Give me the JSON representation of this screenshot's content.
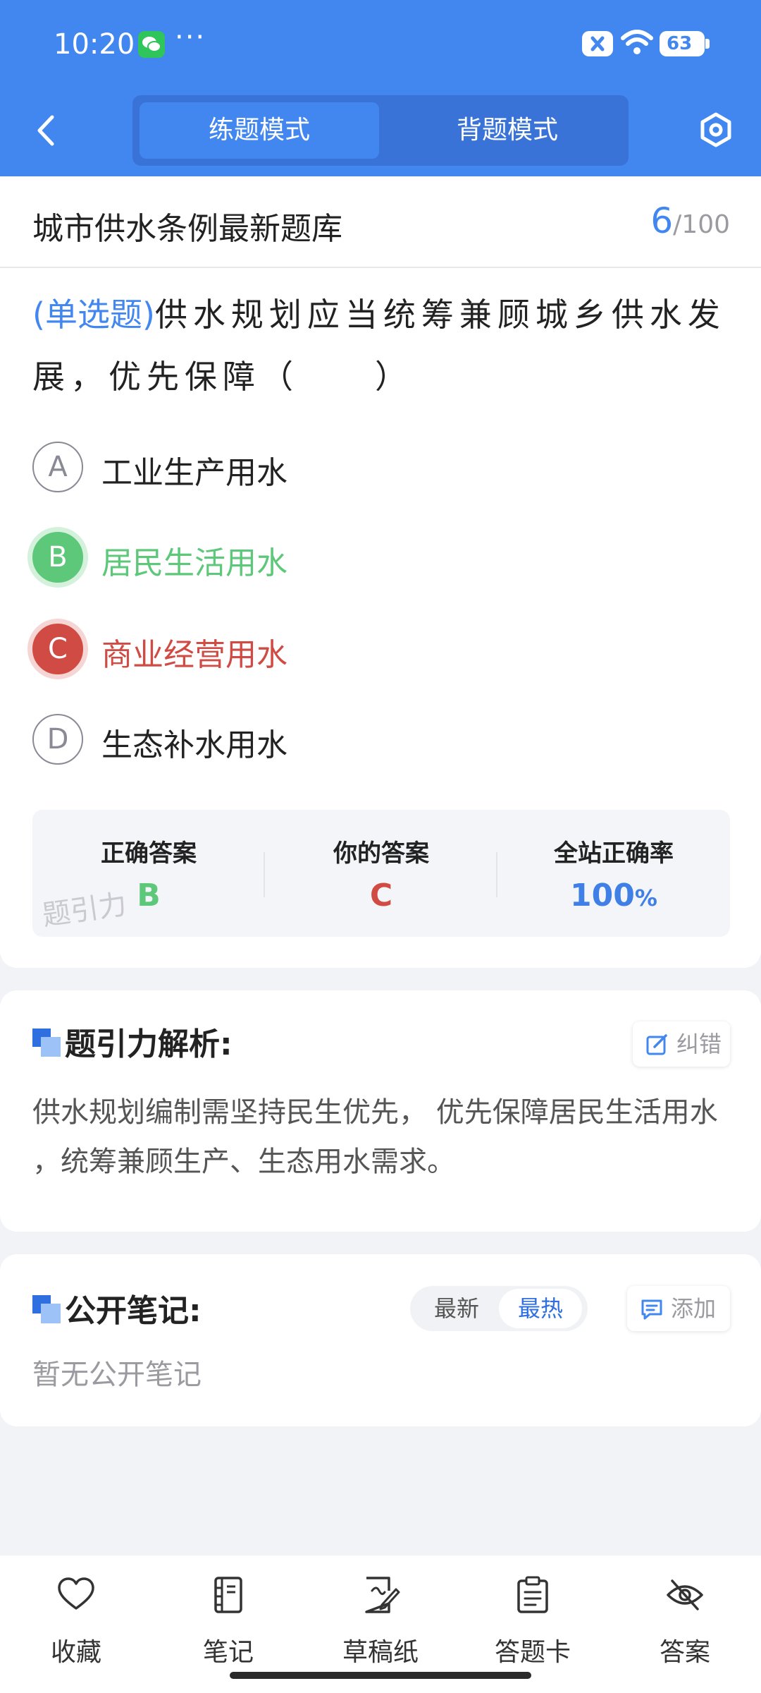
{
  "status_bar": {
    "time": "10:20",
    "overflow": "···",
    "battery": "63"
  },
  "header": {
    "tabs": [
      {
        "label": "练题模式",
        "active": true
      },
      {
        "label": "背题模式",
        "active": false
      }
    ],
    "icons": {
      "back": "chevron-left-icon",
      "settings": "hexagon-gear-icon"
    }
  },
  "title_row": {
    "bank_title": "城市供水条例最新题库",
    "current": "6",
    "total": "/100"
  },
  "question": {
    "type_label": "(单选题)",
    "text": "供水规划应当统筹兼顾城乡供水发展，优先保障（　　）",
    "options": [
      {
        "letter": "A",
        "text": "工业生产用水",
        "state": "normal"
      },
      {
        "letter": "B",
        "text": "居民生活用水",
        "state": "correct"
      },
      {
        "letter": "C",
        "text": "商业经营用水",
        "state": "wrong"
      },
      {
        "letter": "D",
        "text": "生态补水用水",
        "state": "normal"
      }
    ]
  },
  "answer_summary": {
    "correct_label": "正确答案",
    "correct_value": "B",
    "your_label": "你的答案",
    "your_value": "C",
    "rate_label": "全站正确率",
    "rate_value": "100",
    "rate_unit": "%",
    "watermark": "题引力"
  },
  "analysis": {
    "title": "题引力解析:",
    "correct_button": "纠错",
    "text": "供水规划编制需坚持民生优先， 优先保障居民生活用水 ，统筹兼顾生产、生态用水需求。"
  },
  "notes": {
    "title": "公开笔记:",
    "sort_newest": "最新",
    "sort_hottest": "最热",
    "add_button": "添加",
    "empty_text": "暂无公开笔记"
  },
  "bottom_nav": [
    {
      "label": "收藏",
      "icon": "heart-icon"
    },
    {
      "label": "笔记",
      "icon": "notebook-icon"
    },
    {
      "label": "草稿纸",
      "icon": "scratch-paper-icon"
    },
    {
      "label": "答题卡",
      "icon": "answer-card-icon"
    },
    {
      "label": "答案",
      "icon": "eye-off-icon"
    }
  ],
  "colors": {
    "primary": "#4287f0",
    "correct": "#5dc77a",
    "wrong": "#cf4b43",
    "background": "#f2f3f7"
  }
}
